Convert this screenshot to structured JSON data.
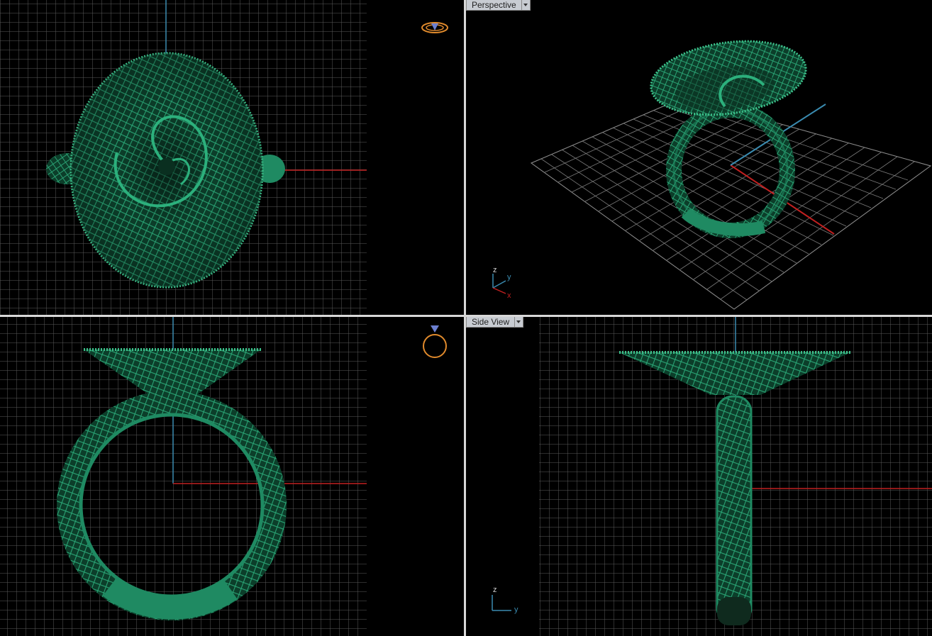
{
  "viewports": {
    "top": {
      "label": ""
    },
    "perspective": {
      "label": "Perspective",
      "axes": {
        "z": "z",
        "y": "y",
        "x": "x"
      }
    },
    "front": {
      "label": ""
    },
    "side": {
      "label": "Side View",
      "axes": {
        "z": "z",
        "y": "y"
      }
    }
  },
  "icons": {
    "top_preview": "ring-top-preview-icon",
    "front_preview": "ring-front-preview-icon",
    "dropdown": "chevron-down-icon"
  },
  "colors": {
    "background": "#000000",
    "grid": "#5a5a5a",
    "model": "#1f8a62",
    "axis_red": "#c02020",
    "axis_blue": "#3a8bb0",
    "label_bg": "#c8ccd2"
  }
}
